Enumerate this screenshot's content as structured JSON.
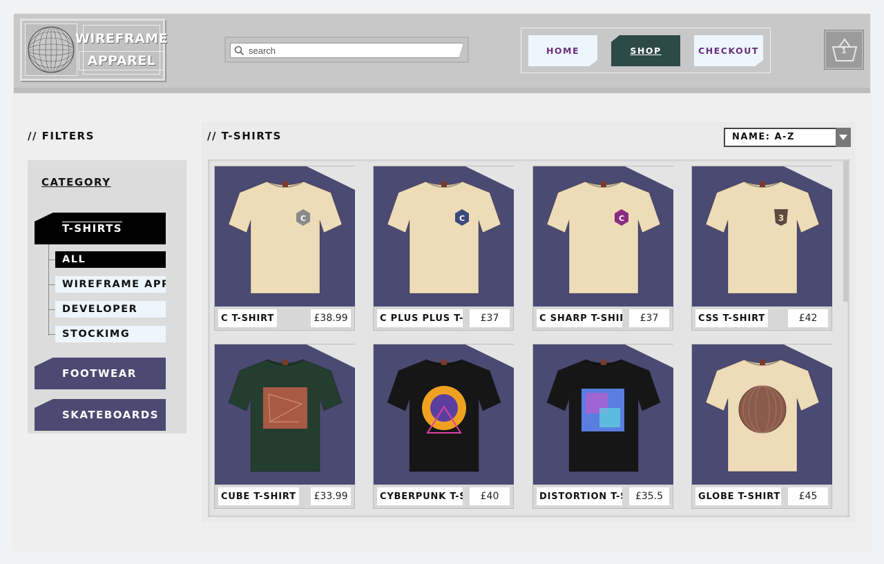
{
  "header": {
    "logo": {
      "line1": "WIREFRAME",
      "line2": "APPAREL"
    },
    "search": {
      "placeholder": "search"
    },
    "nav": [
      {
        "label": "HOME",
        "active": false
      },
      {
        "label": "SHOP",
        "active": true
      },
      {
        "label": "CHECKOUT",
        "active": false
      }
    ],
    "cart": {
      "count": "1"
    }
  },
  "filters": {
    "title": "// FILTERS",
    "category_title": "CATEGORY",
    "categories": [
      {
        "label": "T-SHIRTS",
        "active": true
      },
      {
        "label": "FOOTWEAR",
        "active": false
      },
      {
        "label": "SKATEBOARDS",
        "active": false
      }
    ],
    "subcategories": [
      {
        "label": "ALL",
        "active": true
      },
      {
        "label": "WIREFRAME APPA...",
        "active": false
      },
      {
        "label": "DEVELOPER",
        "active": false
      },
      {
        "label": "STOCKIMG",
        "active": false
      }
    ]
  },
  "products": {
    "title": "// T-SHIRTS",
    "sort": {
      "selected": "NAME: A-Z"
    },
    "items": [
      {
        "name": "C T-SHIRT",
        "price": "£38.99",
        "shirt_color": "#eedcb9",
        "graphic": "c-logo-icon",
        "graphic_color": "#8a8a8a"
      },
      {
        "name": "C PLUS PLUS T-S...",
        "price": "£37",
        "shirt_color": "#eedcb9",
        "graphic": "cpp-logo-icon",
        "graphic_color": "#3b4a7a"
      },
      {
        "name": "C SHARP T-SHIRT",
        "price": "£37",
        "shirt_color": "#eedcb9",
        "graphic": "csharp-logo-icon",
        "graphic_color": "#8b2c7d"
      },
      {
        "name": "CSS T-SHIRT",
        "price": "£42",
        "shirt_color": "#eedcb9",
        "graphic": "css-logo-icon",
        "graphic_color": "#5a4a40"
      },
      {
        "name": "CUBE T-SHIRT",
        "price": "£33.99",
        "shirt_color": "#233e2e",
        "graphic": "wireframe-cube-print",
        "graphic_color": "#a85a45"
      },
      {
        "name": "CYBERPUNK T-S...",
        "price": "£40",
        "shirt_color": "#161616",
        "graphic": "cyberpunk-print",
        "graphic_color": "#f0a020"
      },
      {
        "name": "DISTORTION T-S...",
        "price": "£35.5",
        "shirt_color": "#161616",
        "graphic": "distortion-print",
        "graphic_color": "#5a7de0"
      },
      {
        "name": "GLOBE T-SHIRT",
        "price": "£45",
        "shirt_color": "#eedcb9",
        "graphic": "globe-print",
        "graphic_color": "#8a5a4a"
      }
    ]
  }
}
